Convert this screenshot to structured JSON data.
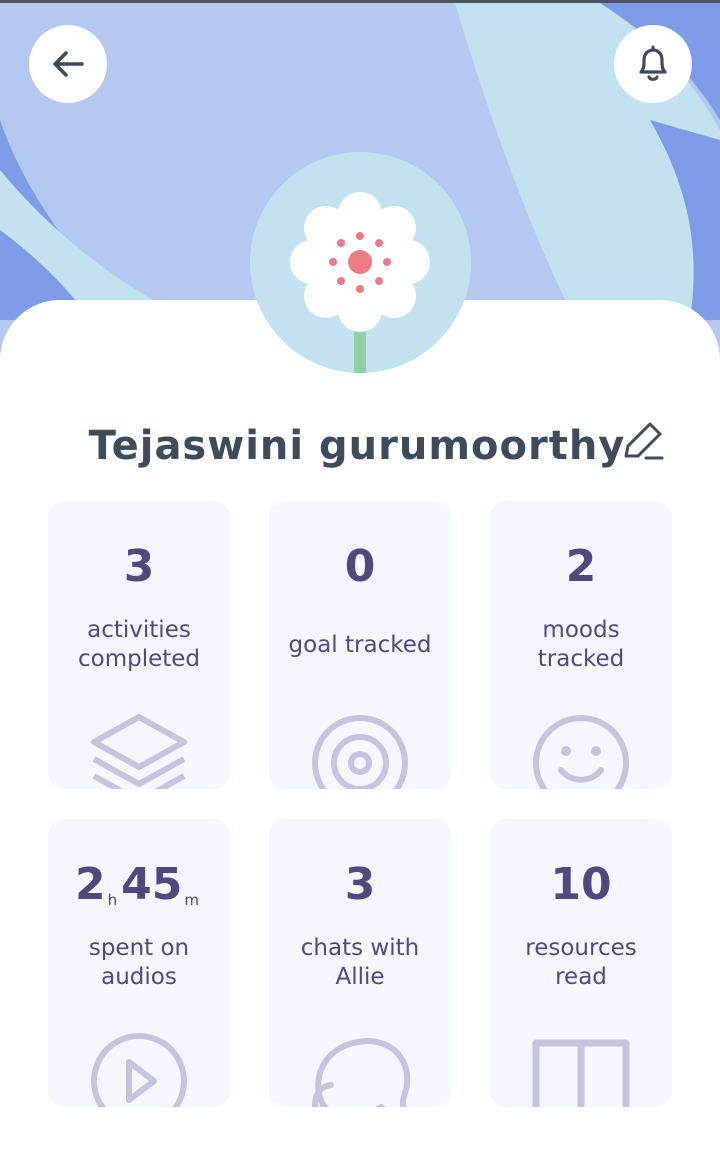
{
  "profile": {
    "name": "Tejaswini gurumoorthy"
  },
  "icons": {
    "back": "arrow-left-icon",
    "notifications": "bell-icon",
    "edit": "pencil-icon",
    "avatar": "flower-avatar"
  },
  "colors": {
    "header_bg": "#b3c7f0",
    "header_wave_light": "#c3e2f0",
    "header_wave_dark": "#7d9be6",
    "card_bg": "#f4f7fd",
    "stat_text": "#4d4a7d",
    "stat_icon": "#c2c5dc",
    "name_text": "#3f4c57"
  },
  "stats": [
    {
      "value": "3",
      "label": "activities completed",
      "icon": "layers-icon"
    },
    {
      "value": "0",
      "label": "goal tracked",
      "icon": "target-icon"
    },
    {
      "value": "2",
      "label": "moods tracked",
      "icon": "smiley-icon"
    },
    {
      "hours": "2",
      "hours_unit": "h",
      "minutes": "45",
      "minutes_unit": "m",
      "label": "spent on audios",
      "icon": "play-icon"
    },
    {
      "value": "3",
      "label": "chats with Allie",
      "icon": "chat-bubble-icon"
    },
    {
      "value": "10",
      "label": "resources read",
      "icon": "book-icon"
    }
  ]
}
